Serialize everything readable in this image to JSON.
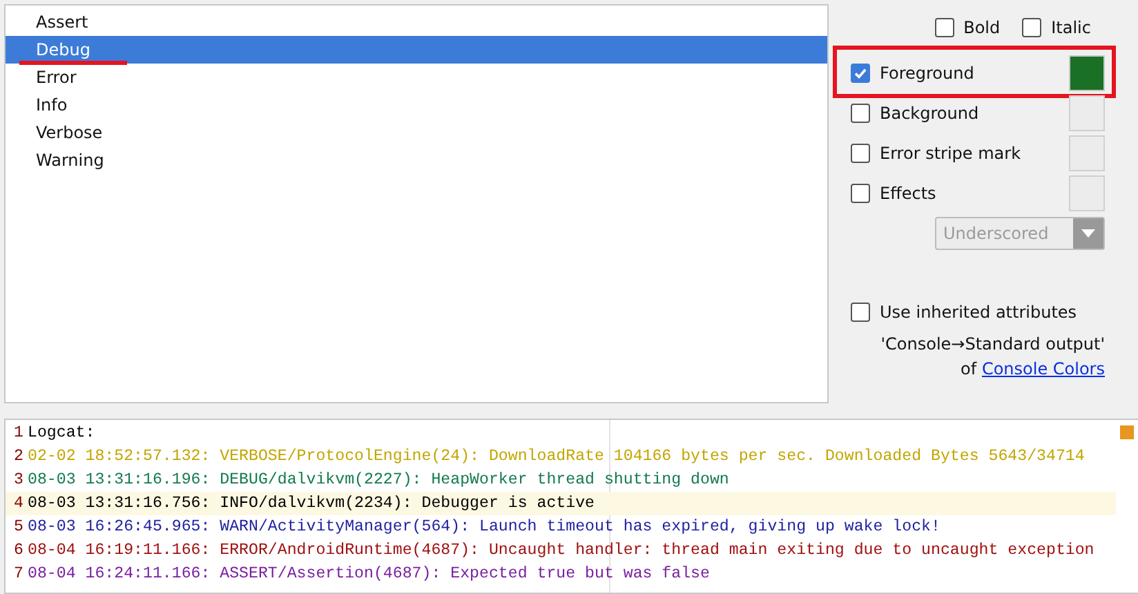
{
  "levels": [
    {
      "label": "Assert",
      "selected": false,
      "underlined": false
    },
    {
      "label": "Debug",
      "selected": true,
      "underlined": true
    },
    {
      "label": "Error",
      "selected": false,
      "underlined": false
    },
    {
      "label": "Info",
      "selected": false,
      "underlined": false
    },
    {
      "label": "Verbose",
      "selected": false,
      "underlined": false
    },
    {
      "label": "Warning",
      "selected": false,
      "underlined": false
    }
  ],
  "font_style": [
    {
      "label": "Bold",
      "checked": false
    },
    {
      "label": "Italic",
      "checked": false
    }
  ],
  "attributes": [
    {
      "label": "Foreground",
      "checked": true,
      "color": "#1a7024",
      "framed": true
    },
    {
      "label": "Background",
      "checked": false,
      "framed": false
    },
    {
      "label": "Error stripe mark",
      "checked": false,
      "framed": false
    },
    {
      "label": "Effects",
      "checked": false,
      "framed": false
    }
  ],
  "effect_dropdown": {
    "value": "Underscored",
    "disabled": true
  },
  "inherit": {
    "label": "Use inherited attributes",
    "checked": false,
    "note": "'Console→Standard output'",
    "prefix": "of",
    "link": "Console Colors"
  },
  "log_lines": [
    {
      "number": "1",
      "text": "Logcat:",
      "color": "#000000",
      "current": false
    },
    {
      "number": "2",
      "text": "02-02 18:52:57.132: VERBOSE/ProtocolEngine(24): DownloadRate 104166 bytes per sec. Downloaded Bytes 5643/34714",
      "color": "#c2a600",
      "current": false
    },
    {
      "number": "3",
      "text": "08-03 13:31:16.196: DEBUG/dalvikvm(2227): HeapWorker thread shutting down",
      "color": "#127a4e",
      "current": false
    },
    {
      "number": "4",
      "text": "08-03 13:31:16.756: INFO/dalvikvm(2234): Debugger is active",
      "color": "#000000",
      "current": true
    },
    {
      "number": "5",
      "text": "08-03 16:26:45.965: WARN/ActivityManager(564): Launch timeout has expired, giving up wake lock!",
      "color": "#1f1fa0",
      "current": false
    },
    {
      "number": "6",
      "text": "08-04 16:19:11.166: ERROR/AndroidRuntime(4687): Uncaught handler: thread main exiting due to uncaught exception",
      "color": "#a01010",
      "current": false
    },
    {
      "number": "7",
      "text": "08-04 16:24:11.166: ASSERT/Assertion(4687): Expected true but was false",
      "color": "#7a1fa0",
      "current": false
    }
  ]
}
